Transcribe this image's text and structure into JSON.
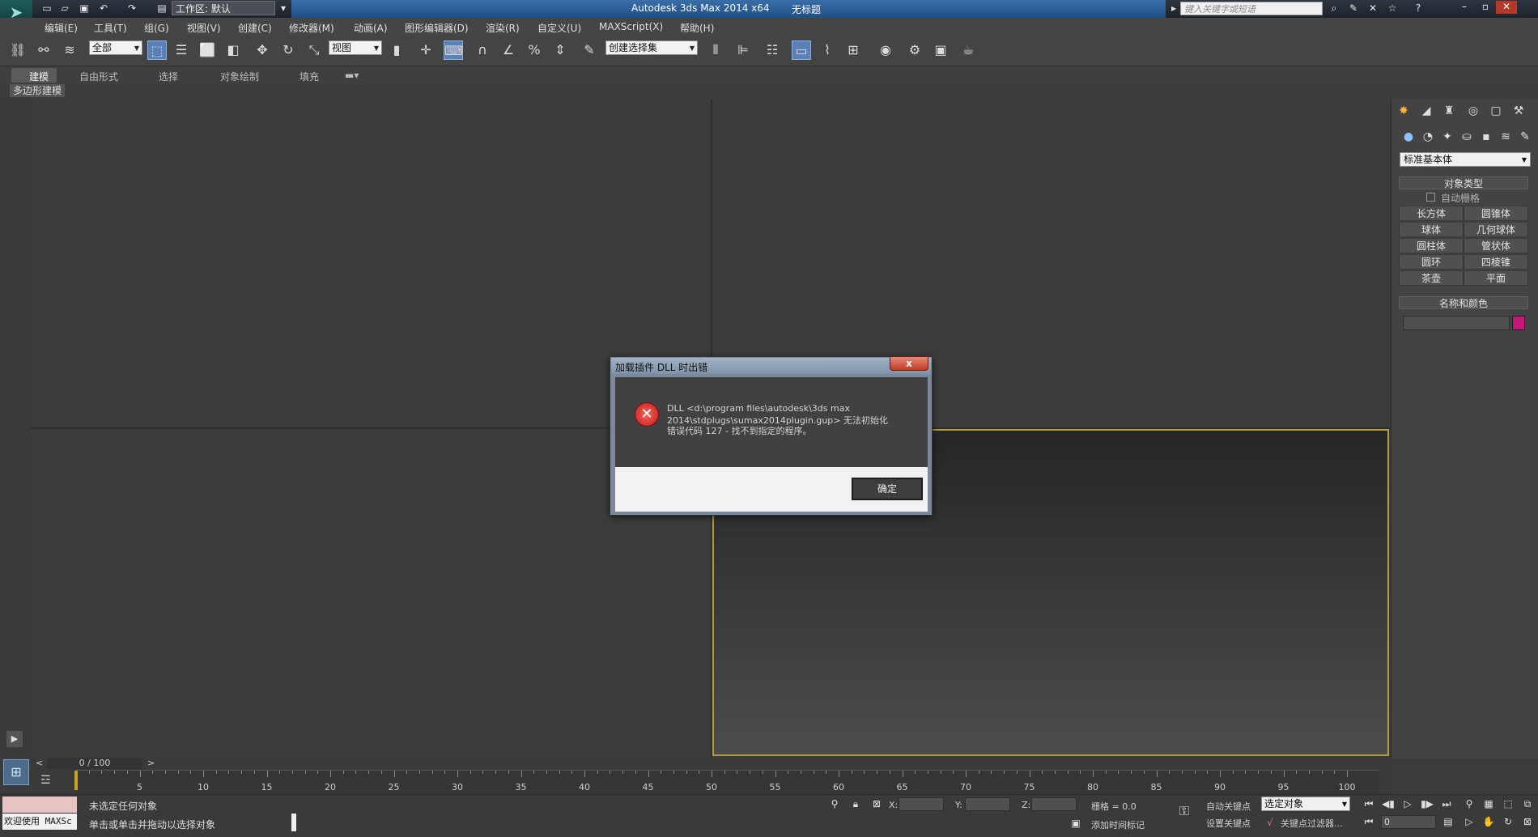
{
  "app": {
    "title": "Autodesk 3ds Max  2014 x64",
    "document": "无标题",
    "logo_icon": "3dsmax-logo-icon",
    "workspace": "工作区: 默认",
    "search_placeholder": "键入关键字或短语"
  },
  "menu": [
    "编辑(E)",
    "工具(T)",
    "组(G)",
    "视图(V)",
    "创建(C)",
    "修改器(M)",
    "动画(A)",
    "图形编辑器(D)",
    "渲染(R)",
    "自定义(U)",
    "MAXScript(X)",
    "帮助(H)"
  ],
  "toolbar": {
    "selection_filter": "全部",
    "ref_coord": "视图",
    "named_selection": "创建选择集"
  },
  "ribbon": {
    "tabs": [
      "建模",
      "自由形式",
      "选择",
      "对象绘制",
      "填充"
    ],
    "active_tab": "建模",
    "subtab": "多边形建模"
  },
  "command_panel": {
    "category": "标准基本体",
    "object_type_title": "对象类型",
    "auto_grid": "自动栅格",
    "primitives": [
      "长方体",
      "圆锥体",
      "球体",
      "几何球体",
      "圆柱体",
      "管状体",
      "圆环",
      "四棱锥",
      "茶壶",
      "平面"
    ],
    "name_color_title": "名称和颜色",
    "color": "#c2187a"
  },
  "timeline": {
    "frame_label": "0 / 100",
    "prev": "<",
    "next": ">",
    "ticks": [
      "5",
      "10",
      "15",
      "20",
      "25",
      "30",
      "35",
      "40",
      "45",
      "50",
      "55",
      "60",
      "65",
      "70",
      "75",
      "80",
      "85",
      "90",
      "95",
      "100"
    ]
  },
  "status": {
    "maxscript_welcome": "欢迎使用 MAXSc",
    "line1": "未选定任何对象",
    "line2": "单击或单击并拖动以选择对象",
    "x_label": "X:",
    "y_label": "Y:",
    "z_label": "Z:",
    "grid": "栅格 = 0.0",
    "add_time_tag": "添加时间标记",
    "auto_key": "自动关键点",
    "set_key": "设置关键点",
    "key_mode": "选定对象",
    "key_filters": "关键点过滤器...",
    "frame": "0"
  },
  "dialog": {
    "title": "加载插件 DLL 时出错",
    "close": "x",
    "message_line1": "DLL <d:\\program files\\autodesk\\3ds max",
    "message_line2": "2014\\stdplugs\\sumax2014plugin.gup> 无法初始化",
    "message_line3": "错误代码 127 - 找不到指定的程序。",
    "ok": "确定",
    "icon": "error-icon"
  }
}
